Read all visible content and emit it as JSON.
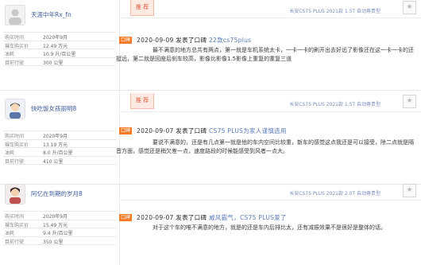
{
  "labels": {
    "recommend": "推 荐",
    "tag": "口碑",
    "published": "发表了口碑",
    "star": "★"
  },
  "stat_keys": [
    "购买时间",
    "裸车购买价",
    "油耗",
    "目前行驶"
  ],
  "reviews": [
    {
      "user": "天涯中年Rx_fn",
      "stats": [
        "2020年9月",
        "12.49 万元",
        "10.9 升/百公里",
        "300 公里"
      ],
      "vehicle": "长安CS75 PLUS 2021款 1.5T 自动尊贵型",
      "date": "2020-09-09",
      "subject": "22款cs75plus",
      "body": "最不满意的地方总共有两点，第一就是车机系统太卡，一卡一卡的刷开出去好远了影像还在这一卡一卡的还挺远，第二就是回座后刹车较高，影像比影像1.5影像上重复的重复三道"
    },
    {
      "user": "快吃饭女孩丽明8",
      "stats": [
        "2020年9月",
        "13.19 万元",
        "8.0 升/百公里",
        "410 公里"
      ],
      "vehicle": "长安CS75 PLUS 2021款 1.5T 自动尊贵型",
      "date": "2020-09-07",
      "subject": "CS75 PLUS为家人谨慎选用",
      "body": "要说不满意的，还是有几点第一就是他的车内空间比较重，新车的感觉这点我还是可以接受，除二点就是隔音方面，感觉还是稍欠差一点，速度路段的时候能感受到风者一点大。"
    },
    {
      "user": "阿忆在到期的岁月8",
      "stats": [
        "2020年9月",
        "15.49 万元",
        "9.4 升/百公里",
        "350 公里"
      ],
      "vehicle": "长安CS75 PLUS 2021款 2.0T 自动尊贵型",
      "date": "2020-09-07",
      "subject": "威风霸气，CS75 PLUS爱了",
      "body": "对于这个车的唯不满意的地方，就是的还是车内后排比太，还有减振效果不是很好是整体的话。"
    }
  ]
}
